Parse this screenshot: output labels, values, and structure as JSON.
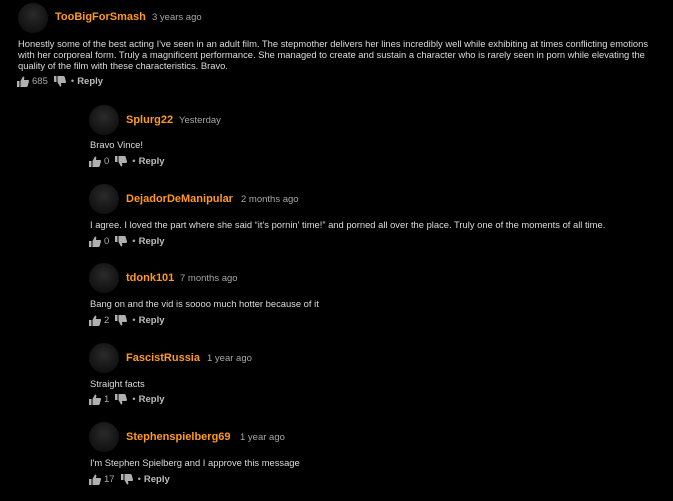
{
  "comments": [
    {
      "username": "TooBigForSmash",
      "time": "3 years ago",
      "text": "Honestly some of the best acting I've seen in an adult film. The stepmother delivers her lines incredibly well while exhibiting at times conflicting emotions with her corporeal form. Truly a magnificent performance. She managed to create and sustain a character who is rarely seen in porn while elevating the quality of the film with these characteristics. Bravo.",
      "likes": "685",
      "reply_label": "Reply",
      "bullet": "•"
    },
    {
      "username": "Splurg22",
      "time": "Yesterday",
      "text": "Bravo Vince!",
      "likes": "0",
      "reply_label": "Reply",
      "bullet": "•"
    },
    {
      "username": "DejadorDeManipular",
      "time": "2 months ago",
      "text": "I agree. I loved the part where she said “it's pornin' time!” and porned all over the place. Truly one of the moments of all time.",
      "likes": "0",
      "reply_label": "Reply",
      "bullet": "•"
    },
    {
      "username": "tdonk101",
      "time": "7 months ago",
      "text": "Bang on and the vid is soooo much hotter because of it",
      "likes": "2",
      "reply_label": "Reply",
      "bullet": "•"
    },
    {
      "username": "FascistRussia",
      "time": "1 year ago",
      "text": "Straight facts",
      "likes": "1",
      "reply_label": "Reply",
      "bullet": "•"
    },
    {
      "username": "Stephenspielberg69",
      "time": "1 year ago",
      "text": "I'm Stephen Spielberg and I approve this message",
      "likes": "17",
      "reply_label": "Reply",
      "bullet": "•"
    }
  ],
  "icons": {
    "like": "thumbs-up-icon",
    "dislike": "thumbs-down-icon"
  },
  "colors": {
    "background": "#000000",
    "username": "#ff9a1f",
    "meta": "#a6a6a6",
    "text": "#dcdcdc"
  }
}
